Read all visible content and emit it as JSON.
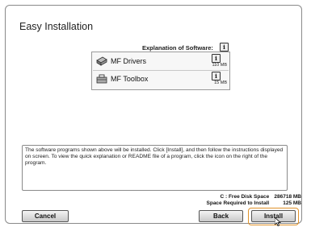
{
  "title": "Easy Installation",
  "explanation_label": "Explanation of Software:",
  "info_icon_text": "i",
  "programs": [
    {
      "name": "MF Drivers",
      "size": "110 MB",
      "icon": "printer-driver-icon"
    },
    {
      "name": "MF Toolbox",
      "size": "15 MB",
      "icon": "toolbox-icon"
    }
  ],
  "description": "The software programs shown above will be installed. Click [Install], and then follow the instructions displayed on screen. To view the quick explanation or README file of a program, click the icon on the right of the program.",
  "disk": {
    "free_label": "C : Free Disk Space",
    "free_value": "286718 MB",
    "required_label": "Space Required to Install",
    "required_value": "125 MB"
  },
  "buttons": {
    "cancel": "Cancel",
    "back": "Back",
    "install": "Install"
  },
  "colors": {
    "focus_outline": "#e0922a"
  }
}
